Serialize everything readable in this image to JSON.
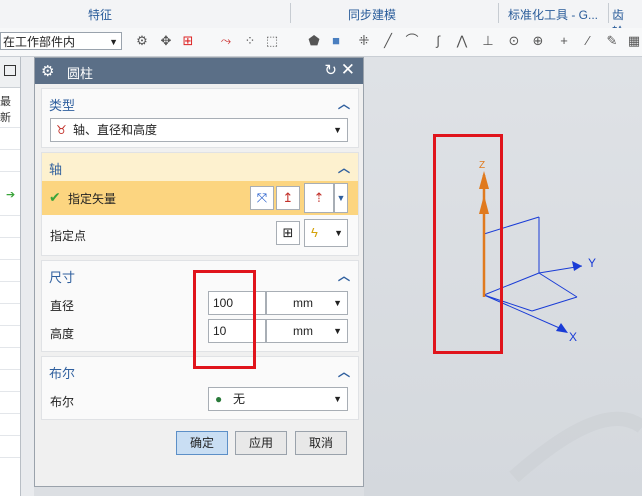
{
  "ribbon": {
    "groups": [
      "特征",
      "同步建模",
      "标准化工具 - G...",
      "齿轮..."
    ]
  },
  "toolbar": {
    "scope_value": "在工作部件内"
  },
  "navigator": {
    "update_label": "最新"
  },
  "dialog": {
    "title": "圆柱",
    "type_section": {
      "label": "类型",
      "selected": "轴、直径和高度"
    },
    "axis_section": {
      "label": "轴",
      "specify_vector": "指定矢量",
      "specify_point": "指定点"
    },
    "dimension_section": {
      "label": "尺寸",
      "diameter_label": "直径",
      "diameter_value": "100",
      "diameter_unit": "mm",
      "height_label": "高度",
      "height_value": "10",
      "height_unit": "mm"
    },
    "boolean_section": {
      "label": "布尔",
      "boolean_label": "布尔",
      "boolean_value": "无"
    },
    "buttons": {
      "ok": "确定",
      "apply": "应用",
      "cancel": "取消"
    }
  },
  "viewport": {
    "axis_labels": {
      "z": "Z",
      "y": "Y",
      "x": "X"
    }
  },
  "colors": {
    "dialog_title_bg": "#5b6f87",
    "section_label": "#2f5f9e",
    "highlight_row": "#fcd580",
    "annotation_red": "#e0141c",
    "vector_orange": "#e07a1e",
    "csys_blue": "#1a3cd6"
  }
}
